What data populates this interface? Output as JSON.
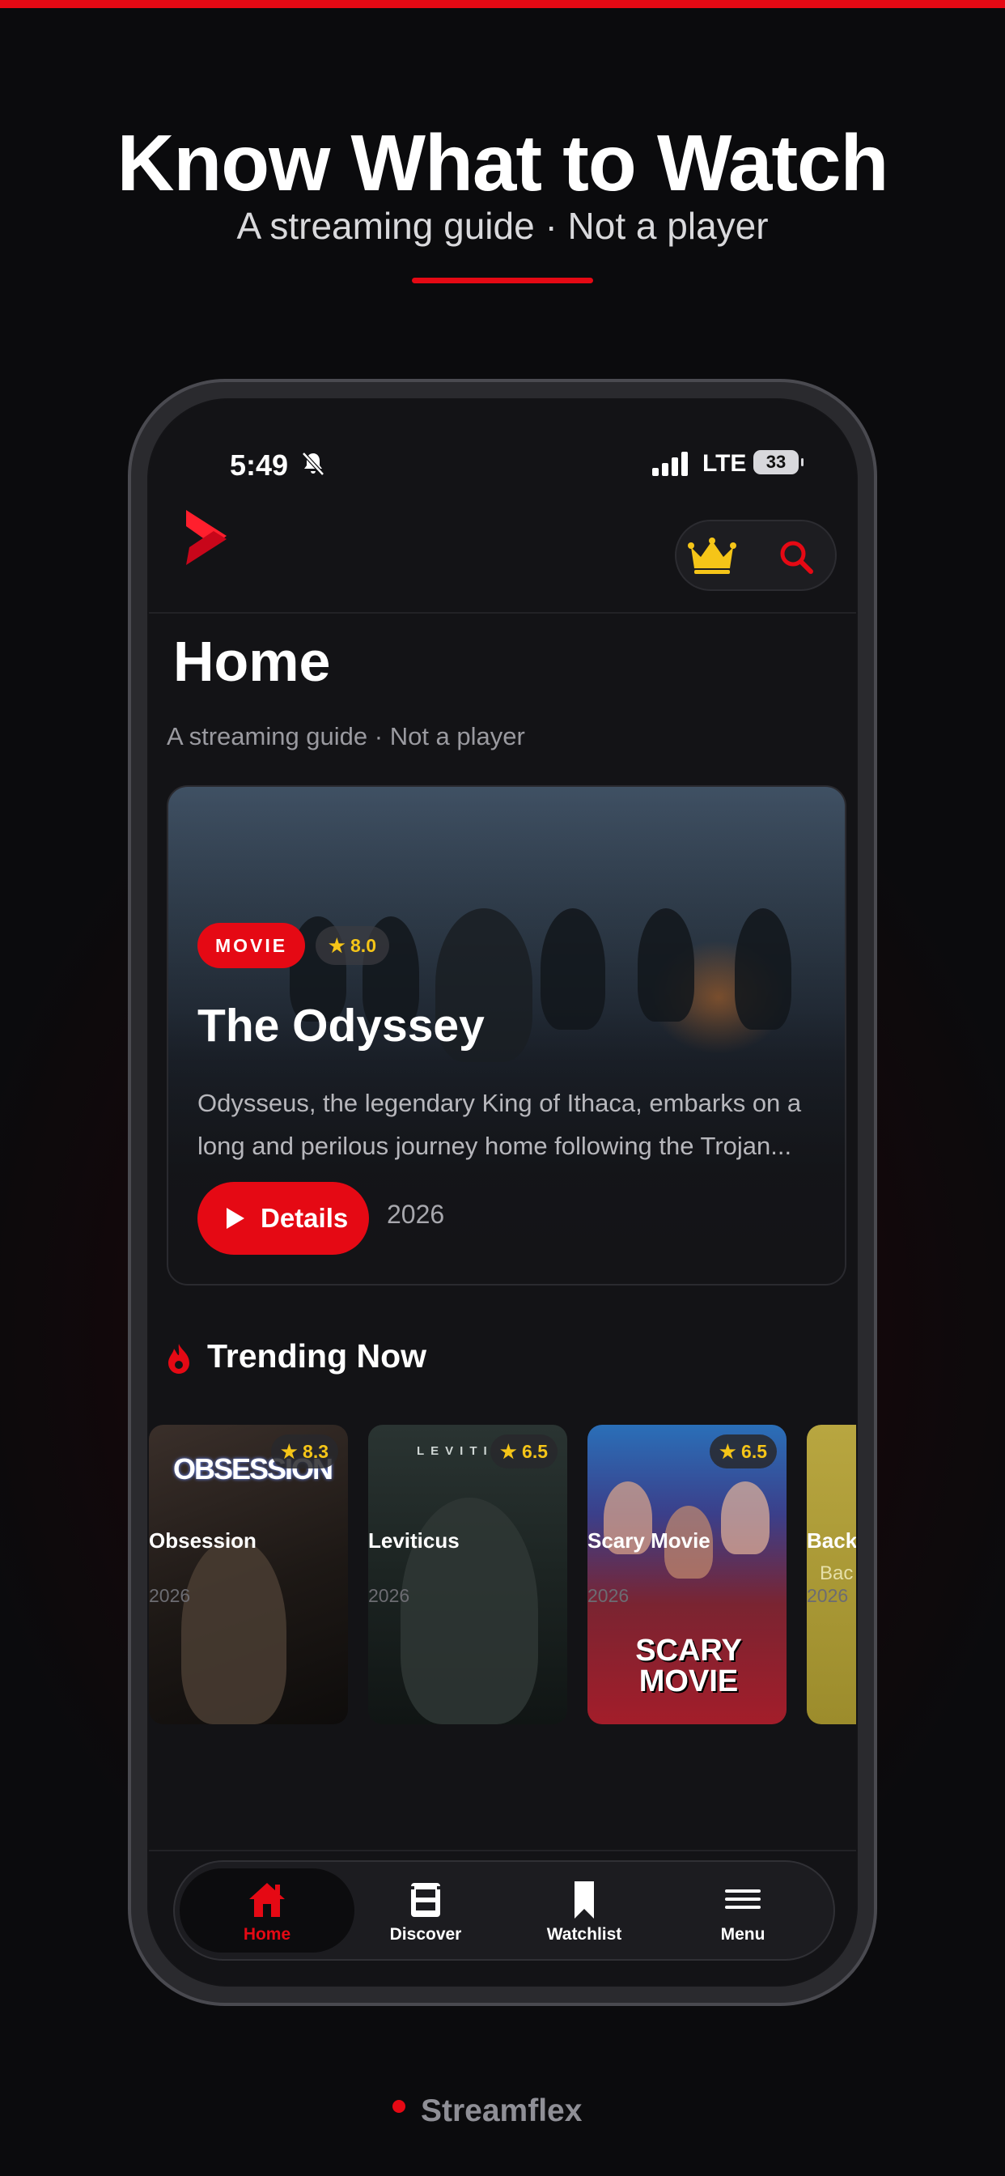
{
  "banner": {
    "title": "Know What to Watch",
    "subtitle": "A streaming guide · Not a player"
  },
  "status_bar": {
    "time": "5:49",
    "network": "LTE",
    "battery": "33"
  },
  "app": {
    "page_title": "Home",
    "page_subtitle": "A streaming guide · Not a player"
  },
  "featured": {
    "type_badge": "MOVIE",
    "rating": "★ 8.0",
    "title": "The Odyssey",
    "description": "Odysseus, the legendary King of Ithaca, embarks on a long and perilous journey home following the Trojan...",
    "button_label": "Details",
    "year": "2026"
  },
  "trending": {
    "section_title": "Trending Now",
    "items": [
      {
        "title": "Obsession",
        "year": "2026",
        "rating": "★ 8.3",
        "poster_text": "OBSESSION"
      },
      {
        "title": "Leviticus",
        "year": "2026",
        "rating": "★ 6.5",
        "poster_text": "LEVITI"
      },
      {
        "title": "Scary Movie",
        "year": "2026",
        "rating": "★ 6.5",
        "poster_text": "SCARY MOVIE"
      },
      {
        "title": "Backı",
        "year": "2026",
        "rating": "",
        "poster_text": "Bac"
      }
    ]
  },
  "tabs": [
    {
      "label": "Home",
      "icon": "home-icon",
      "active": true
    },
    {
      "label": "Discover",
      "icon": "film-icon",
      "active": false
    },
    {
      "label": "Watchlist",
      "icon": "bookmark-icon",
      "active": false
    },
    {
      "label": "Menu",
      "icon": "menu-icon",
      "active": false
    }
  ],
  "footer": {
    "brand": "Streamflex"
  },
  "colors": {
    "accent": "#e50914",
    "gold": "#f5c518",
    "background": "#0b0b0d",
    "surface": "#131316"
  }
}
